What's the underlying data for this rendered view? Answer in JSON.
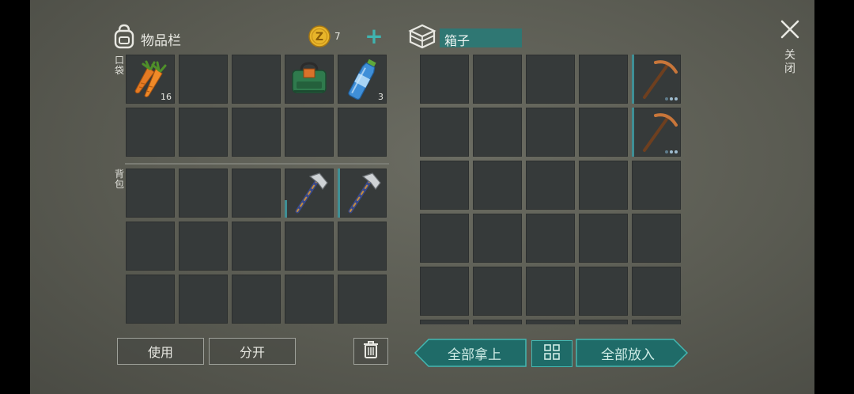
{
  "inventory": {
    "title": "物品栏",
    "coin_count": "7",
    "add_symbol": "+",
    "pocket_label": "口袋",
    "backpack_label": "背包",
    "pocket_slots": [
      {
        "item": "carrot",
        "count": "16"
      },
      {
        "item": ""
      },
      {
        "item": ""
      },
      {
        "item": "green-bag"
      },
      {
        "item": "water-bottle",
        "count": "3"
      },
      {
        "item": ""
      },
      {
        "item": ""
      },
      {
        "item": ""
      },
      {
        "item": ""
      },
      {
        "item": ""
      }
    ],
    "backpack_slots": [
      {
        "item": ""
      },
      {
        "item": ""
      },
      {
        "item": ""
      },
      {
        "item": "hatchet"
      },
      {
        "item": "hatchet"
      },
      {
        "item": ""
      },
      {
        "item": ""
      },
      {
        "item": ""
      },
      {
        "item": ""
      },
      {
        "item": ""
      },
      {
        "item": ""
      },
      {
        "item": ""
      },
      {
        "item": ""
      },
      {
        "item": ""
      },
      {
        "item": ""
      }
    ],
    "use_button": "使用",
    "split_button": "分开"
  },
  "box": {
    "title": "箱子",
    "take_all_button": "全部拿上",
    "put_all_button": "全部放入",
    "first_column_items": [
      "pickaxe",
      "pickaxe"
    ]
  },
  "close_label": "关闭",
  "colors": {
    "accent": "#3fb4b0",
    "slot": "#363a3a",
    "panel": "#5f6058"
  }
}
